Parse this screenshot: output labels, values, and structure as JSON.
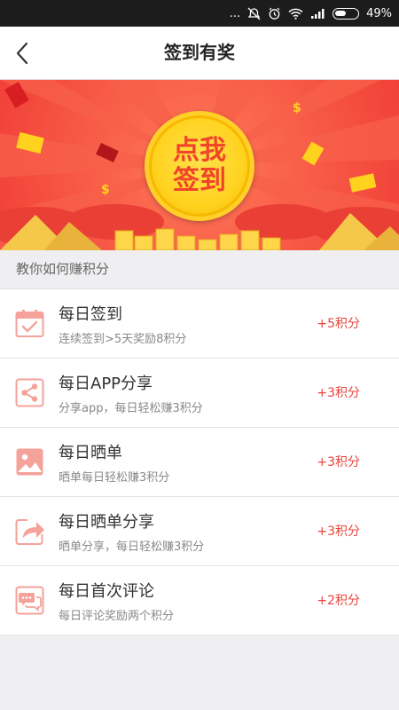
{
  "status_bar": {
    "battery": "49%",
    "more_dots": "..."
  },
  "header": {
    "title": "签到有奖"
  },
  "banner": {
    "checkin_label": "点我签到"
  },
  "section": {
    "title": "教你如何赚积分"
  },
  "tasks": [
    {
      "title": "每日签到",
      "desc": "连续签到>5天奖励8积分",
      "points": "+5积分",
      "icon": "calendar-check-icon"
    },
    {
      "title": "每日APP分享",
      "desc": "分享app，每日轻松赚3积分",
      "points": "+3积分",
      "icon": "share-icon"
    },
    {
      "title": "每日晒单",
      "desc": "晒单每日轻松赚3积分",
      "points": "+3积分",
      "icon": "image-icon"
    },
    {
      "title": "每日晒单分享",
      "desc": "晒单分享，每日轻松赚3积分",
      "points": "+3积分",
      "icon": "forward-icon"
    },
    {
      "title": "每日首次评论",
      "desc": "每日评论奖励两个积分",
      "points": "+2积分",
      "icon": "comment-icon"
    }
  ],
  "colors": {
    "accent": "#e8453a",
    "banner_red": "#f35446",
    "coin_gold": "#ffd21e",
    "icon_pink": "#f4a29a"
  }
}
